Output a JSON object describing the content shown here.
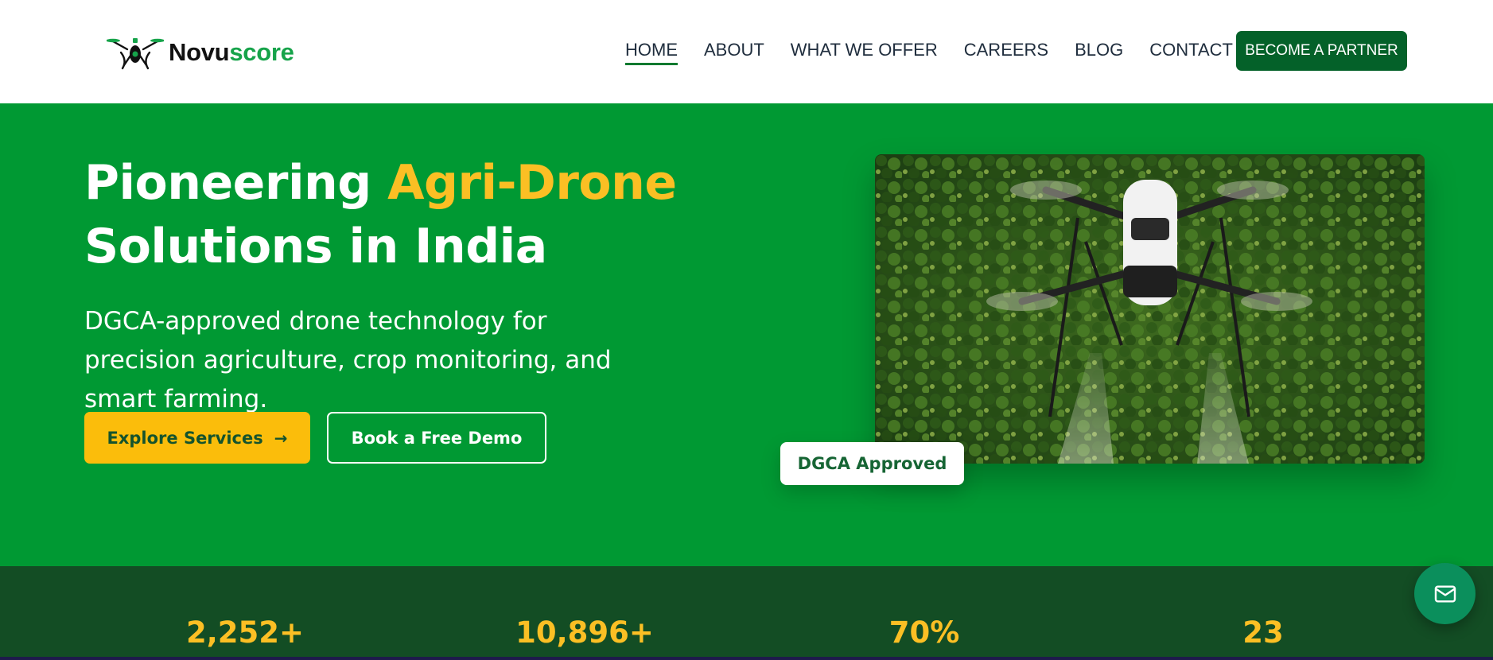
{
  "brand": {
    "name_part1": "Novu",
    "name_part2": "score"
  },
  "nav": {
    "items": [
      {
        "label": "HOME",
        "active": true
      },
      {
        "label": "ABOUT",
        "active": false
      },
      {
        "label": "WHAT WE OFFER",
        "active": false
      },
      {
        "label": "CAREERS",
        "active": false
      },
      {
        "label": "BLOG",
        "active": false
      },
      {
        "label": "CONTACT US",
        "active": false
      }
    ],
    "cta_label": "BECOME A PARTNER"
  },
  "hero": {
    "title_part1": "Pioneering ",
    "title_highlight": "Agri-Drone",
    "title_part2": "Solutions in India",
    "subtitle": "DGCA-approved drone technology for precision agriculture, crop monitoring, and smart farming.",
    "primary_button": "Explore Services",
    "primary_button_icon": "arrow-right-icon",
    "secondary_button": "Book a Free Demo",
    "badge": "DGCA Approved"
  },
  "stats": [
    {
      "value": "2,252+"
    },
    {
      "value": "10,896+"
    },
    {
      "value": "70%"
    },
    {
      "value": "23"
    }
  ],
  "floating_button": {
    "icon": "mail-icon"
  },
  "colors": {
    "hero_bg": "#009933",
    "accent_yellow": "#fbbd0b",
    "dark_green": "#046129",
    "stats_bg": "#134d24",
    "fab_green": "#0b8f5c"
  }
}
